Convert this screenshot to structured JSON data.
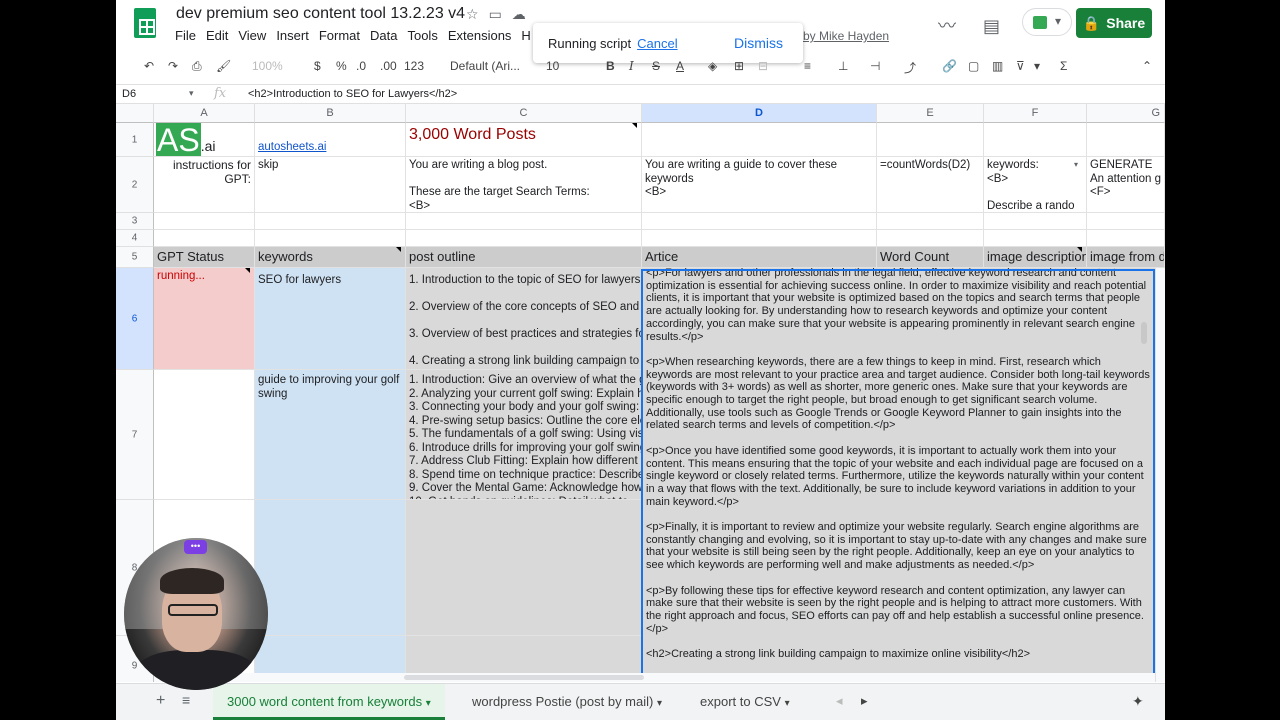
{
  "doc": {
    "title": "dev premium seo content tool 13.2.23 v4",
    "byline": "o by Mike Hayden",
    "share_label": "Share"
  },
  "menu": [
    "File",
    "Edit",
    "View",
    "Insert",
    "Format",
    "Data",
    "Tools",
    "Extensions",
    "H"
  ],
  "toast": {
    "text": "Running script",
    "cancel": "Cancel",
    "dismiss": "Dismiss"
  },
  "toolbar": {
    "zoom": "100%",
    "currency": "$",
    "percent": "%",
    "dec_dec": ".0",
    "dec_inc": ".00",
    "format": "123",
    "font": "Default (Ari...",
    "size": "10"
  },
  "formula_bar": {
    "namebox": "D6",
    "fx": "fx",
    "formula": "<h2>Introduction to SEO for Lawyers</h2>"
  },
  "columns": [
    "A",
    "B",
    "C",
    "D",
    "E",
    "F",
    "G"
  ],
  "rows": [
    "1",
    "2",
    "3",
    "4",
    "5",
    "6",
    "7",
    "8",
    "9"
  ],
  "row1": {
    "logo_as": "AS",
    "logo_ai": ".ai",
    "link": "autosheets.ai",
    "title": "3,000 Word Posts"
  },
  "row2": {
    "a": "instructions for\nGPT:",
    "b": "skip",
    "c": "You are writing a blog post.\n\nThese are the target Search Terms:\n<B>",
    "d": "You are writing a guide to cover these keywords\n<B>\n\nThe guide is going to cover:",
    "e": "=countWords(D2)",
    "f": "keywords:\n<B>\n\nDescribe a rando",
    "g": "GENERATE\nAn attention g\n<F>"
  },
  "row5": {
    "a": "GPT Status",
    "b": "keywords",
    "c": "post outline",
    "d": "Artice",
    "e": "Word Count",
    "f": "image description",
    "g": "image from d"
  },
  "row6": {
    "a": "running...",
    "b": "SEO for lawyers",
    "c": "1. Introduction to the topic of SEO for lawyers,\n\n2. Overview of the core concepts of SEO and t\n\n3. Overview of best practices and strategies fo\n\n4. Creating a strong link building campaign to r"
  },
  "row7": {
    "b": "guide to improving your golf swing",
    "c": "1. Introduction: Give an overview of what the g\n2. Analyzing your current golf swing: Explain h\n3. Connecting your body and your golf swing: D\n4. Pre-swing setup basics: Outline the core ele\n5. The fundamentals of a golf swing: Using visu\n6. Introduce drills for improving your golf swing\n7. Address Club Fitting: Explain how different c\n8. Spend time on technique practice: Describe\n9. Cover the Mental Game: Acknowledge how\n10. Get hands on guidelines: Detail what to"
  },
  "article": [
    "<p>For lawyers and other professionals in the legal field, effective keyword research and content optimization is essential for achieving success online. In order to maximize visibility and reach potential clients, it is important that your website is optimized based on the topics and search terms that people are actually looking for. By understanding how to research keywords and optimize your content accordingly, you can make sure that your website is appearing prominently in relevant search engine results.</p>",
    "<p>When researching keywords, there are a few things to keep in mind. First, research which keywords are most relevant to your practice area and target audience. Consider both long-tail keywords (keywords with 3+ words) as well as shorter, more generic ones. Make sure that your keywords are specific enough to target the right people, but broad enough to get significant search volume. Additionally, use tools such as Google Trends or Google Keyword Planner to gain insights into the related search terms and levels of competition.</p>",
    "<p>Once you have identified some good keywords, it is important to actually work them into your content. This means ensuring that the topic of your website and each individual page are focused on a single keyword or closely related terms. Furthermore, utilize the keywords naturally within your content in a way that flows with the text. Additionally, be sure to include keyword variations in addition to your main keyword.</p>",
    "<p>Finally, it is important to review and optimize your website regularly. Search engine algorithms are constantly changing and evolving, so it is important to stay up-to-date with any changes and make sure that your website is still being seen by the right people. Additionally, keep an eye on your analytics to see which keywords are performing well and make adjustments as needed.</p>",
    "<p>By following these tips for effective keyword research and content optimization, any lawyer can make sure that their website is seen by the right people and is helping to attract more customers. With the right approach and focus, SEO efforts can pay off and help establish a successful online presence.</p>",
    "<h2>Creating a strong link building campaign to maximize online visibility</h2>"
  ],
  "tabs": [
    "3000 word content from keywords",
    "wordpress Postie (post by mail)",
    "export to CSV"
  ],
  "colors": {
    "accent": "#1a73e8",
    "share": "#188038",
    "status_running": "#f4cccc",
    "keywords_bg": "#cfe2f3",
    "header_bg": "#cccccc"
  }
}
